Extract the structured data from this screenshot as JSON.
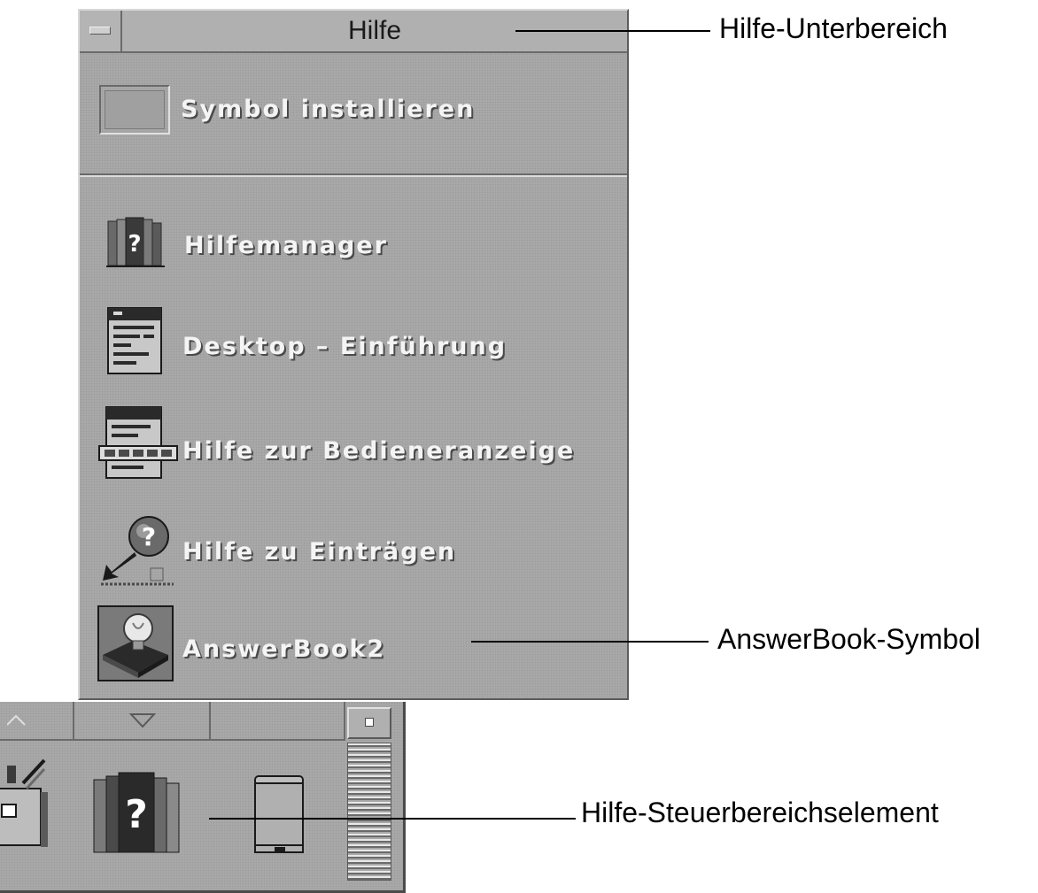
{
  "subpanel": {
    "title": "Hilfe",
    "install_label": "Symbol installieren",
    "items": [
      {
        "label": "Hilfemanager",
        "icon": "help-books-icon"
      },
      {
        "label": "Desktop – Einführung",
        "icon": "desktop-intro-icon"
      },
      {
        "label": "Hilfe zur Bedieneranzeige",
        "icon": "front-panel-help-icon"
      },
      {
        "label": "Hilfe zu Einträgen",
        "icon": "on-item-help-icon"
      },
      {
        "label": "AnswerBook2",
        "icon": "answerbook-icon"
      }
    ]
  },
  "callouts": {
    "subpanel": "Hilfe-Unterbereich",
    "answerbook": "AnswerBook-Symbol",
    "control": "Hilfe-Steuerbereichselement"
  },
  "colors": {
    "panel_gray": "#a8a8a8",
    "label_text": "#f4f4f4"
  }
}
